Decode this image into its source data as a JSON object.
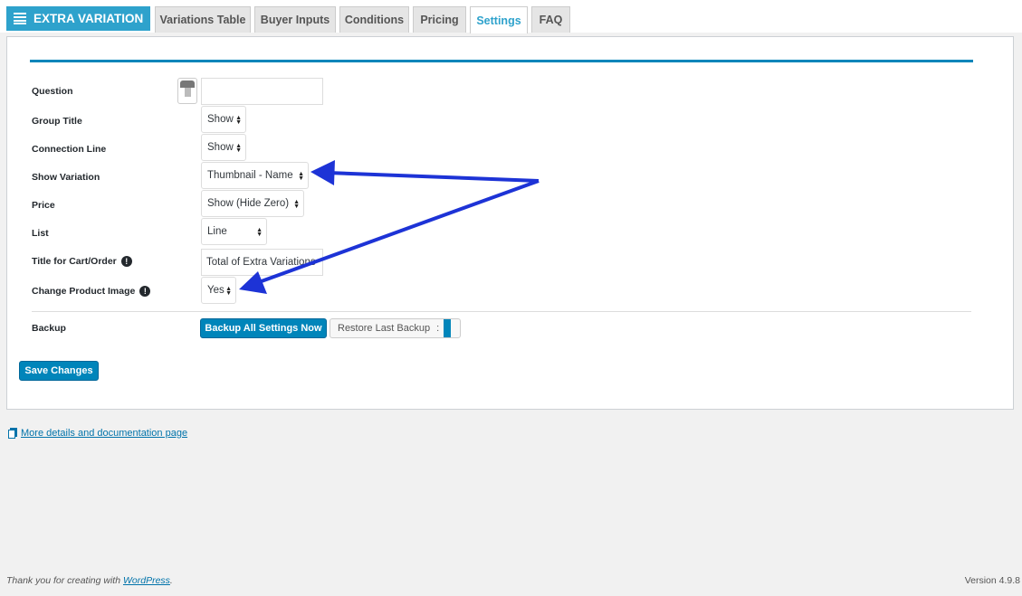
{
  "header": {
    "brand": "EXTRA VARIATION",
    "tabs": [
      {
        "label": "Variations Table"
      },
      {
        "label": "Buyer Inputs"
      },
      {
        "label": "Conditions"
      },
      {
        "label": "Pricing"
      },
      {
        "label": "Settings",
        "active": true
      },
      {
        "label": "FAQ"
      }
    ]
  },
  "settings": {
    "question": {
      "label": "Question",
      "value": ""
    },
    "group_title": {
      "label": "Group Title",
      "value": "Show"
    },
    "connection_line": {
      "label": "Connection Line",
      "value": "Show"
    },
    "show_variation": {
      "label": "Show Variation",
      "value": "Thumbnail - Name"
    },
    "price": {
      "label": "Price",
      "value": "Show (Hide Zero)"
    },
    "list": {
      "label": "List",
      "value": "Line"
    },
    "title_cart_order": {
      "label": "Title for Cart/Order",
      "value": "Total of Extra Variations"
    },
    "change_product_image": {
      "label": "Change Product Image",
      "value": "Yes"
    },
    "backup": {
      "label": "Backup",
      "backup_button": "Backup All Settings Now",
      "restore_button": "Restore Last Backup",
      "restore_separator": ":"
    },
    "save_button": "Save Changes"
  },
  "links": {
    "docs": "More details and documentation page"
  },
  "footer": {
    "thanks_prefix": "Thank you for creating with",
    "wordpress": "WordPress",
    "thanks_suffix": ".",
    "version": "Version 4.9.8"
  },
  "icons": {
    "brand": "list-icon",
    "info": "info-icon",
    "docs": "book-icon"
  },
  "colors": {
    "brand_bg": "#2ea2cc",
    "primary_button": "#0085ba",
    "annotation_arrow": "#1d33d6"
  }
}
